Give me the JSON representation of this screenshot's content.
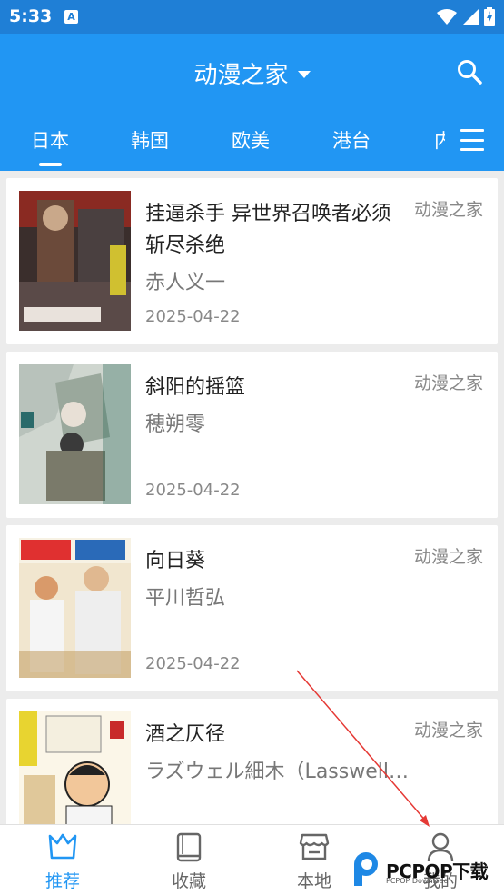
{
  "status_bar": {
    "time": "5:33",
    "notification_icon": "a-box-icon",
    "system_icons": [
      "wifi-icon",
      "signal-icon",
      "battery-charging-icon"
    ]
  },
  "app_bar": {
    "title": "动漫之家",
    "dropdown_icon": "caret-down-icon",
    "search_icon": "search-icon"
  },
  "tabs": [
    {
      "label": "日本",
      "active": true
    },
    {
      "label": "韩国",
      "active": false
    },
    {
      "label": "欧美",
      "active": false
    },
    {
      "label": "港台",
      "active": false
    },
    {
      "label": "内",
      "active": false
    }
  ],
  "menu_icon": "hamburger-menu-icon",
  "comics": [
    {
      "title": "挂逼杀手 异世界召唤者必须斩尽杀绝",
      "author": "赤人义一",
      "date": "2025-04-22",
      "source": "动漫之家"
    },
    {
      "title": "斜阳的摇篮",
      "author": "穂朔零",
      "date": "2025-04-22",
      "source": "动漫之家"
    },
    {
      "title": "向日葵",
      "author": "平川哲弘",
      "date": "2025-04-22",
      "source": "动漫之家"
    },
    {
      "title": "酒之仄径",
      "author": "ラズウェル細木（Lasswell Hosoki）",
      "date": "",
      "source": "动漫之家"
    }
  ],
  "bottom_nav": [
    {
      "label": "推荐",
      "icon": "crown-basket-icon",
      "active": true
    },
    {
      "label": "收藏",
      "icon": "book-icon",
      "active": false
    },
    {
      "label": "本地",
      "icon": "store-icon",
      "active": false
    },
    {
      "label": "我的",
      "icon": "person-icon",
      "active": false
    }
  ],
  "watermark": {
    "text": "PCPOP下载",
    "sub": "PCPOP Download"
  },
  "colors": {
    "primary": "#2196f3",
    "status_bar": "#1f7fd6",
    "active_nav": "#2196f3",
    "background": "#ececec",
    "arrow": "#e53935"
  }
}
